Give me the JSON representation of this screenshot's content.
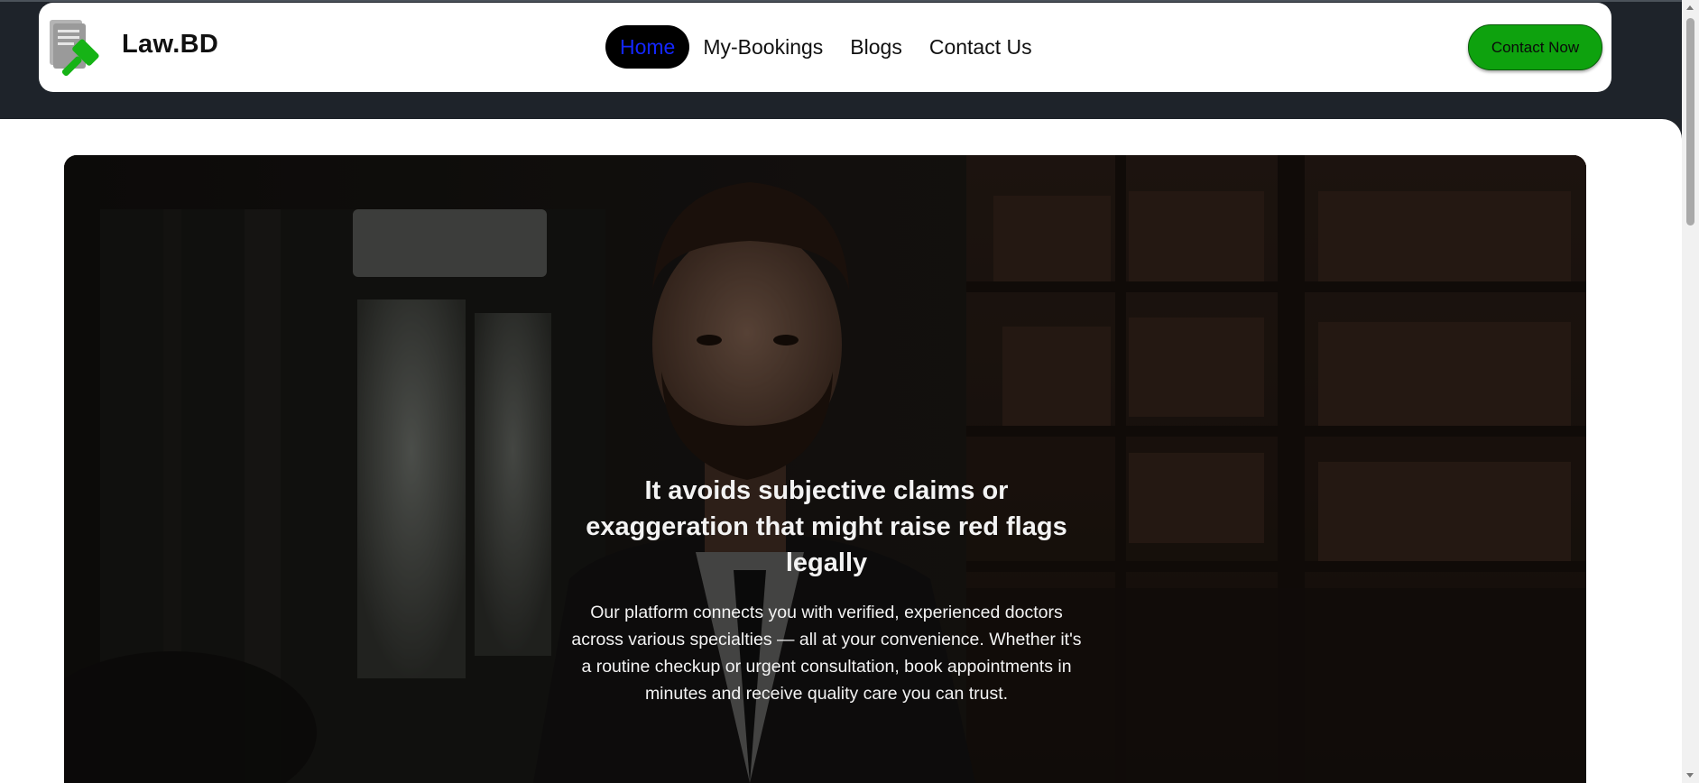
{
  "navbar": {
    "logo_icon": "legal-document-gavel-icon",
    "brand": "Law.BD",
    "links": [
      {
        "label": "Home",
        "active": true
      },
      {
        "label": "My-Bookings",
        "active": false
      },
      {
        "label": "Blogs",
        "active": false
      },
      {
        "label": "Contact Us",
        "active": false
      }
    ],
    "cta_label": "Contact Now"
  },
  "hero": {
    "title": "It avoids subjective claims or exaggeration that might raise red flags legally",
    "description": "Our platform connects you with verified, experienced doctors across various specialties — all at your convenience. Whether it's a routine checkup or urgent consultation, book appointments in minutes and receive quality care you can trust."
  },
  "colors": {
    "accent_green": "#0ea20e",
    "active_link_bg": "#000000",
    "active_link_text": "#1326ff",
    "header_band": "#1e232a"
  }
}
